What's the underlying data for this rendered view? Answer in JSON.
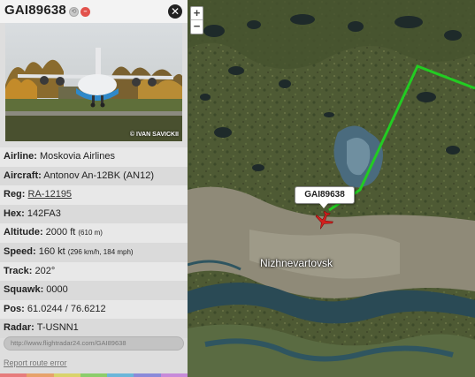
{
  "flight": {
    "callsign": "GAI89638",
    "close_icon": "close-icon",
    "history_icon": "history-icon",
    "remove_icon": "remove-icon"
  },
  "photo": {
    "credit": "© IVAN SAVICKII"
  },
  "details": {
    "airline_label": "Airline:",
    "airline": "Moskovia Airlines",
    "aircraft_label": "Aircraft:",
    "aircraft": "Antonov An-12BK (AN12)",
    "reg_label": "Reg:",
    "reg": "RA-12195",
    "hex_label": "Hex:",
    "hex": "142FA3",
    "altitude_label": "Altitude:",
    "altitude": "2000 ft",
    "altitude_metric": "(610 m)",
    "speed_label": "Speed:",
    "speed": "160 kt",
    "speed_metric": "(296 km/h, 184 mph)",
    "track_label": "Track:",
    "track": "202°",
    "squawk_label": "Squawk:",
    "squawk": "0000",
    "pos_label": "Pos:",
    "pos": "61.0244 / 76.6212",
    "radar_label": "Radar:",
    "radar": "T-USNN1"
  },
  "share_url": "http://www.flightradar24.com/GAI89638",
  "report_link": "Report route error",
  "map": {
    "zoom_in": "+",
    "zoom_out": "−",
    "callout": "GAI89638",
    "city": "Nizhnevartovsk",
    "route_color": "#22cc22",
    "aircraft_color": "#d2201d"
  },
  "color_strip": [
    "#e77c7c",
    "#e7a26a",
    "#d9d36b",
    "#8ccd6b",
    "#6bb6d9",
    "#8a8ad9",
    "#c78ad9"
  ]
}
